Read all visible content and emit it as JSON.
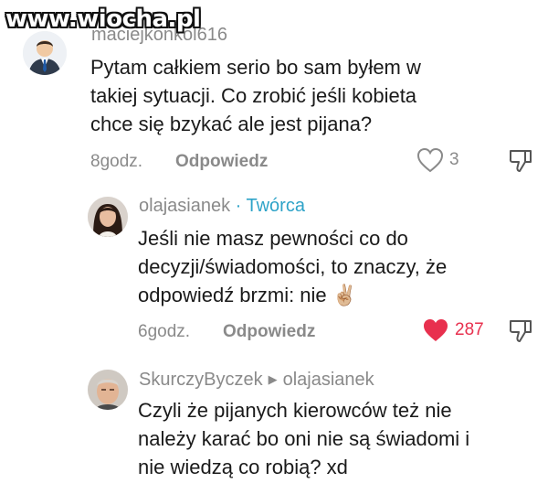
{
  "watermark": "www.wiocha.pl",
  "comments": [
    {
      "username": "maciejkonkol616",
      "text_lines": [
        "Pytam całkiem serio bo sam byłem w",
        "takiej sytuacji. Co zrobić jeśli kobieta",
        "chce się bzykać ale jest pijana?"
      ],
      "time": "8godz.",
      "reply_label": "Odpowiedz",
      "likes": "3",
      "liked": false
    },
    {
      "username": "olajasianek",
      "badge": "· Twórca",
      "text_lines": [
        "Jeśli nie masz pewności co do",
        "decyzji/świadomości, to znaczy, że",
        "odpowiedź brzmi: nie ✌🏼"
      ],
      "time": "6godz.",
      "reply_label": "Odpowiedz",
      "likes": "287",
      "liked": true,
      "accent_color": "#e8304e",
      "creator_color": "#2ea3c8"
    },
    {
      "username": "SkurczyByczek",
      "reply_to": "olajasianek",
      "text_lines": [
        "Czyli że pijanych kierowców też nie",
        "należy karać bo oni nie są świadomi i",
        "nie wiedzą co robią? xd"
      ]
    }
  ],
  "icons": {
    "like": "heart-outline-icon",
    "liked": "heart-filled-icon",
    "dislike": "thumbs-down-icon",
    "reply_arrow": "triangle-right-icon"
  }
}
